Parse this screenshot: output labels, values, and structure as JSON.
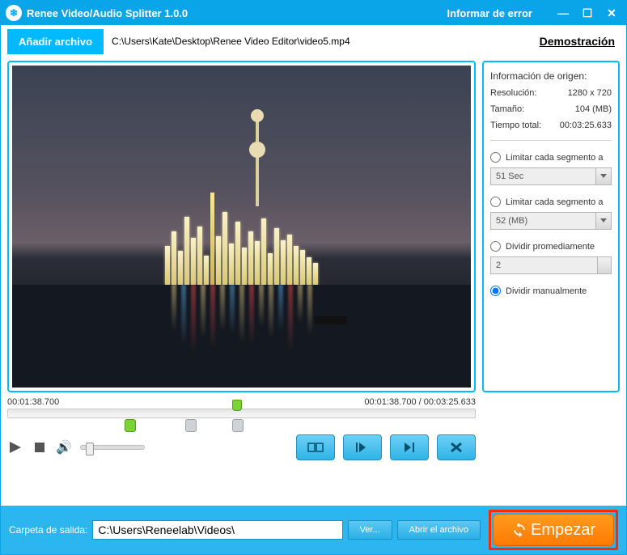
{
  "titlebar": {
    "app_title": "Renee Video/Audio Splitter 1.0.0",
    "report_error": "Informar de error"
  },
  "toolbar": {
    "add_file": "Añadir archivo",
    "file_path": "C:\\Users\\Kate\\Desktop\\Renee Video Editor\\video5.mp4",
    "demo": "Demostración"
  },
  "timeline": {
    "current": "00:01:38.700",
    "position": "00:01:38.700",
    "total": "00:03:25.633"
  },
  "info": {
    "heading": "Información de origen:",
    "resolution_label": "Resolución:",
    "resolution_value": "1280 x 720",
    "size_label": "Tamaño:",
    "size_value": "104 (MB)",
    "time_label": "Tiempo total:",
    "time_value": "00:03:25.633"
  },
  "options": {
    "limit_seg_time": "Limitar cada segmento a",
    "seg_time_value": "51 Sec",
    "limit_seg_size": "Limitar cada segmento a",
    "seg_size_value": "52 (MB)",
    "split_avg": "Dividir promediamente",
    "split_avg_value": "2",
    "split_manual": "Dividir manualmente"
  },
  "footer": {
    "out_label": "Carpeta de salida:",
    "out_path": "C:\\Users\\Reneelab\\Videos\\",
    "view": "Ver...",
    "open": "Abrir el archivo",
    "start": "Empezar"
  }
}
